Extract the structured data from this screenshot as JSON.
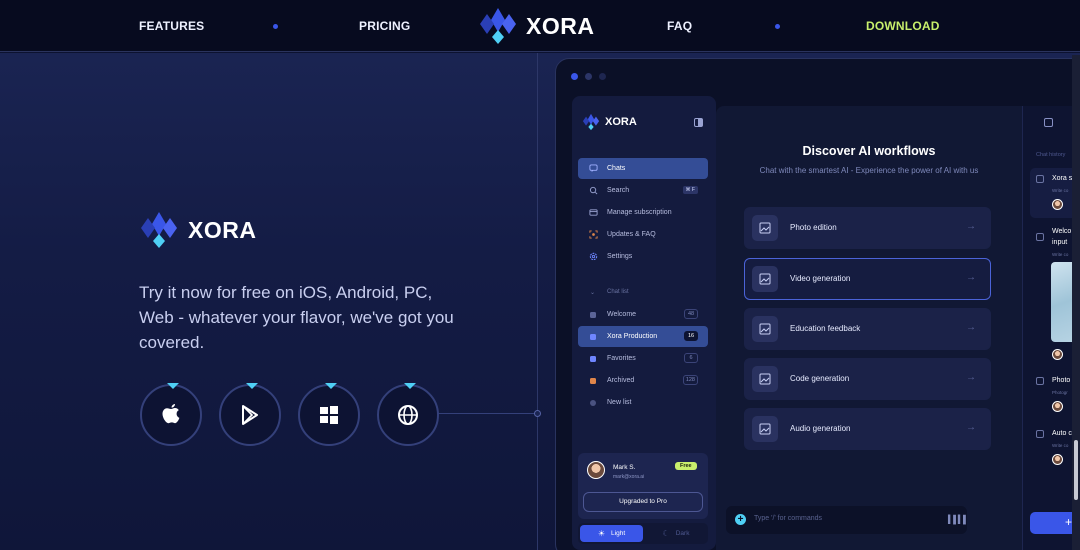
{
  "nav": {
    "links": [
      "FEATURES",
      "PRICING",
      "FAQ",
      "DOWNLOAD"
    ],
    "brand": "XORA"
  },
  "hero": {
    "brand": "XORA",
    "text": "Try it now for free on iOS, Android, PC, Web - whatever your flavor, we've got you covered.",
    "platforms": [
      "apple-icon",
      "google-play-icon",
      "windows-icon",
      "web-icon"
    ]
  },
  "app": {
    "brand": "XORA",
    "menu": [
      {
        "label": "Chats",
        "icon": "chat-icon",
        "active": true
      },
      {
        "label": "Search",
        "icon": "search-icon",
        "shortcut": "⌘ F"
      },
      {
        "label": "Manage subscription",
        "icon": "card-icon"
      },
      {
        "label": "Updates & FAQ",
        "icon": "updates-icon"
      },
      {
        "label": "Settings",
        "icon": "gear-icon"
      }
    ],
    "chat_list_label": "Chat list",
    "lists": [
      {
        "label": "Welcome",
        "count": "48",
        "color": "#5b6497"
      },
      {
        "label": "Xora Production",
        "count": "16",
        "color": "#6f86ff",
        "active": true
      },
      {
        "label": "Favorites",
        "count": "6",
        "color": "#6f86ff"
      },
      {
        "label": "Archived",
        "count": "128",
        "color": "#e0864a"
      },
      {
        "label": "New list",
        "count": "",
        "color": "#9aa3d2"
      }
    ],
    "user": {
      "name": "Mark S.",
      "email": "mark@xora.ai",
      "plan": "Free"
    },
    "upgrade_label": "Upgraded to Pro",
    "theme": {
      "light": "Light",
      "dark": "Dark"
    },
    "main": {
      "title": "Discover AI workflows",
      "subtitle": "Chat with the smartest AI - Experience the power of AI with us",
      "workflows": [
        "Photo edition",
        "Video generation",
        "Education feedback",
        "Code generation",
        "Audio generation"
      ],
      "prompt_placeholder": "Type '/' for commands"
    },
    "history": {
      "header": "Chat history",
      "items": [
        {
          "title": "Xora s",
          "sub": "Write co"
        },
        {
          "title": "Welco",
          "title2": "input",
          "sub": "Write co"
        },
        {
          "title": "Photo",
          "sub": "Photogr"
        },
        {
          "title": "Auto c",
          "sub": "Write co"
        }
      ],
      "new_button": "+"
    }
  },
  "colors": {
    "accent": "#3a56e8",
    "cyan": "#4fd0f5",
    "lime": "#c8ef6c",
    "bg": "#0c1230"
  }
}
